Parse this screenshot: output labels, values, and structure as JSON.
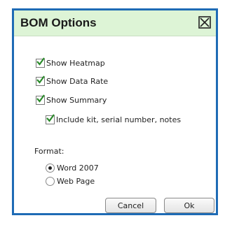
{
  "dialog": {
    "title": "BOM Options",
    "close_icon": "close-box-icon"
  },
  "options": {
    "show_heatmap": {
      "label": "Show Heatmap",
      "checked": true
    },
    "show_data_rate": {
      "label": "Show Data Rate",
      "checked": true
    },
    "show_summary": {
      "label": "Show Summary",
      "checked": true
    },
    "include_kit": {
      "label": "Include kit, serial number, notes",
      "checked": true
    }
  },
  "format": {
    "label": "Format:",
    "options": [
      {
        "label": "Word 2007",
        "selected": true
      },
      {
        "label": "Web Page",
        "selected": false
      }
    ]
  },
  "buttons": {
    "cancel": "Cancel",
    "ok": "Ok"
  },
  "colors": {
    "border": "#1e6bb5",
    "title_bg": "#ddf4d6",
    "check": "#2a8a2a"
  }
}
